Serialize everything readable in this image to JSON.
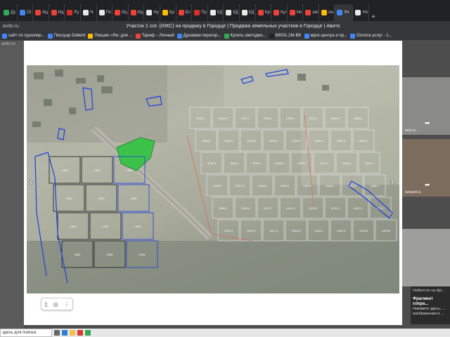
{
  "tabs": [
    {
      "label": "Ду",
      "color": "#34a853"
    },
    {
      "label": "23.",
      "color": "#4285f4"
    },
    {
      "label": "Ид",
      "color": "#ea4335"
    },
    {
      "label": "Ид",
      "color": "#ea4335"
    },
    {
      "label": "Ру",
      "color": "#d93025"
    },
    {
      "label": "%",
      "color": "#e8e8e8"
    },
    {
      "label": "Пл",
      "color": "#e8e8e8"
    },
    {
      "label": "Ид",
      "color": "#ea4335"
    },
    {
      "label": "Ид",
      "color": "#ea4335"
    },
    {
      "label": "Ну",
      "color": "#e8e8e8"
    },
    {
      "label": "Бр",
      "color": "#fbbc04"
    },
    {
      "label": "Бп",
      "color": "#ea4335"
    },
    {
      "label": "Пр",
      "color": "#d93025"
    },
    {
      "label": "КД",
      "color": "#e8e8e8"
    },
    {
      "label": "КД",
      "color": "#e8e8e8"
    },
    {
      "label": "КД",
      "color": "#e8e8e8"
    },
    {
      "label": "Кул",
      "color": "#ea4335"
    },
    {
      "label": "Кул",
      "color": "#ea4335"
    },
    {
      "label": "Но",
      "color": "#ea4335"
    },
    {
      "label": "авт",
      "color": "#ea4335"
    },
    {
      "label": "Ан",
      "color": "#fbbc04"
    },
    {
      "label": "Уч",
      "color": "#4285f4"
    },
    {
      "label": "Но",
      "color": "#e8e8e8"
    }
  ],
  "active_tab_index": 21,
  "new_tab_label": "+",
  "address": {
    "url": "avito.ru",
    "title": "Участок 1 сот. (ИЖС) на продажу в Городце | Продажа земельных участков в Городце | Авито"
  },
  "bookmarks": [
    {
      "label": "сайт по грузопер...",
      "color": "#4285f4"
    },
    {
      "label": "Писсуар Geberit",
      "color": "#4285f4"
    },
    {
      "label": "Письмо «Re: для ...",
      "color": "#fbbc04"
    },
    {
      "label": "Тариф – Лечный",
      "color": "#ea4335"
    },
    {
      "label": "Душевая перегор...",
      "color": "#4285f4"
    },
    {
      "label": "Купить светодио...",
      "color": "#34a853"
    },
    {
      "label": "60001-2M-BK",
      "color": "#222222"
    },
    {
      "label": "мрск центра и пр...",
      "color": "#4285f4"
    },
    {
      "label": "Оплата услуг - 1...",
      "color": "#4285f4"
    }
  ],
  "site_logo": "avito.ru",
  "photo": {
    "lots": [
      "2292.2",
      "2312.4",
      "2314.1",
      "2316.1",
      "1436.0",
      "1574.1",
      "2284.4",
      "1380.4",
      "2356.8",
      "1352.6",
      "1254.8",
      "1420.4",
      "1376.8",
      "1484.4",
      "1497.4",
      "1300.1",
      "1276.4",
      "1254.4",
      "1232.5",
      "1245.8",
      "1325.4",
      "1271.4",
      "1254.8",
      "1257.2",
      "1298.4",
      "1227.8",
      "1244.8",
      "1420.6",
      "1362.8",
      "1448.2",
      "1403.2",
      "1350.7",
      "1390.1",
      "1256.4",
      "1217.7",
      "1412.4",
      "1312.6",
      "1211.4",
      "1432.1",
      "1373.7",
      "1425.3",
      "1457.8",
      "1317.4",
      "1324.8",
      "1226.2",
      "1415.3",
      "1412.6",
      "1458.8"
    ],
    "west_lots": [
      "1460",
      "1548",
      "1590",
      "2460",
      "2400",
      "2456",
      "2490",
      "1490",
      "2490",
      "1562",
      "2586",
      "2494"
    ]
  },
  "nav": {
    "prev": "‹",
    "next": "›"
  },
  "close_label": "✕",
  "toolbar_icons": [
    "bookmark-icon",
    "camera-icon",
    "more-vertical-icon"
  ],
  "toolbar_glyphs": {
    "bookmark": "▯",
    "camera": "◎",
    "more": "⋮"
  },
  "side_thumbs": [
    {
      "caption": "mdo.ru",
      "share": "➦"
    },
    {
      "caption": "lanbuild.ru",
      "share": "➦"
    },
    {
      "caption": "",
      "share": ""
    }
  ],
  "toast": {
    "head": "Набросок на фр...",
    "title": "Фрагмент сохра...",
    "body": "Нажмите здесь, ... изображения и ..."
  },
  "taskbar": {
    "search": "здесь для поиска"
  }
}
